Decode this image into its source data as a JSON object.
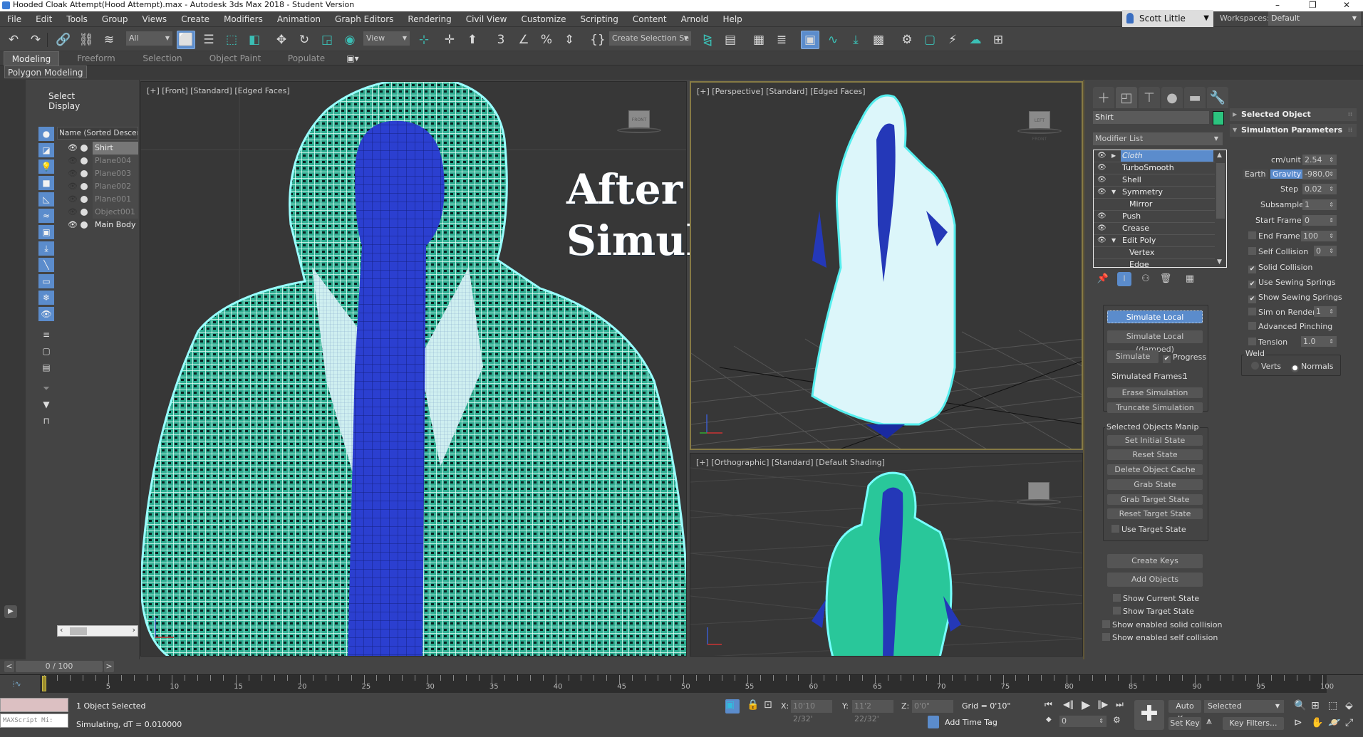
{
  "window": {
    "title": "Hooded Cloak Attempt(Hood Attempt).max - Autodesk 3ds Max 2018 - Student Version",
    "controls": [
      "minimize",
      "restore",
      "close"
    ]
  },
  "menu": {
    "items": [
      "File",
      "Edit",
      "Tools",
      "Group",
      "Views",
      "Create",
      "Modifiers",
      "Animation",
      "Graph Editors",
      "Rendering",
      "Civil View",
      "Customize",
      "Scripting",
      "Content",
      "Arnold",
      "Help"
    ],
    "user": "Scott Little",
    "workspaces_label": "Workspaces:",
    "workspace": "Default"
  },
  "toolbar": {
    "selection_filter": "All",
    "ref_coord": "View",
    "named_selection": "Create Selection Se"
  },
  "ribbon": {
    "tabs": [
      "Modeling",
      "Freeform",
      "Selection",
      "Object Paint",
      "Populate"
    ],
    "active_tab": "Modeling",
    "panel": "Polygon Modeling"
  },
  "explorer": {
    "tabs": [
      "Select",
      "Display"
    ],
    "column_header": "Name (Sorted Descend",
    "objects": [
      {
        "name": "Shirt",
        "visible": true,
        "selected": true
      },
      {
        "name": "Plane004",
        "visible": false,
        "selected": false
      },
      {
        "name": "Plane003",
        "visible": false,
        "selected": false
      },
      {
        "name": "Plane002",
        "visible": false,
        "selected": false
      },
      {
        "name": "Plane001",
        "visible": false,
        "selected": false
      },
      {
        "name": "Object001",
        "visible": false,
        "selected": false
      },
      {
        "name": "Main Body",
        "visible": true,
        "selected": false
      }
    ]
  },
  "viewports": {
    "front": "[+] [Front] [Standard] [Edged Faces]",
    "perspective": "[+] [Perspective] [Standard] [Edged Faces]",
    "orthographic": "[+] [Orthographic] [Standard] [Default Shading]",
    "overlay_line1": "After",
    "overlay_line2": "Simulation",
    "viewcube_front": "FRONT",
    "viewcube_persp_left": "LEFT",
    "viewcube_persp_front": "FRONT"
  },
  "command_panel": {
    "object_name": "Shirt",
    "object_color": "#2cc47f",
    "modifier_list": "Modifier List",
    "stack": [
      {
        "label": "Cloth",
        "selected": true,
        "expand": "collapsed"
      },
      {
        "label": "TurboSmooth"
      },
      {
        "label": "Shell"
      },
      {
        "label": "Symmetry",
        "expand": "expanded"
      },
      {
        "label": "Mirror",
        "sub": true
      },
      {
        "label": "Push"
      },
      {
        "label": "Crease"
      },
      {
        "label": "Edit Poly",
        "expand": "expanded"
      },
      {
        "label": "Vertex",
        "sub": true
      },
      {
        "label": "Edge",
        "sub": true
      }
    ],
    "buttons": {
      "simulate_local": "Simulate Local",
      "simulate_local_damped": "Simulate Local (damped)",
      "simulate": "Simulate",
      "progress": "Progress",
      "simulated_frames_label": "Simulated Frames:",
      "simulated_frames_value": "1",
      "erase_simulation": "Erase Simulation",
      "truncate_simulation": "Truncate Simulation"
    },
    "manip": {
      "title": "Selected Objects Manip",
      "set_initial_state": "Set Initial State",
      "reset_state": "Reset State",
      "delete_object_cache": "Delete Object Cache",
      "grab_state": "Grab State",
      "grab_target_state": "Grab Target State",
      "reset_target_state": "Reset Target State",
      "use_target_state": "Use Target State"
    },
    "create_keys": "Create Keys",
    "add_objects": "Add Objects",
    "show_current_state": "Show Current State",
    "show_target_state": "Show Target State",
    "show_enabled_solid": "Show enabled solid collision",
    "show_enabled_self": "Show enabled self collision"
  },
  "sim_params": {
    "selected_object": "Selected Object",
    "title": "Simulation Parameters",
    "cm_unit_label": "cm/unit",
    "cm_unit": "2.54",
    "earth": "Earth",
    "gravity": "Gravity",
    "gravity_value": "-980.0",
    "step_label": "Step",
    "step": "0.02",
    "subsample_label": "Subsample",
    "subsample": "1",
    "start_frame_label": "Start Frame",
    "start_frame": "0",
    "end_frame_label": "End Frame",
    "end_frame": "100",
    "self_collision_label": "Self Collision",
    "self_collision": "0",
    "solid_collision": "Solid Collision",
    "use_sewing": "Use Sewing Springs",
    "show_sewing": "Show Sewing Springs",
    "sim_on_render_label": "Sim on Render",
    "sim_on_render": "1",
    "advanced_pinching": "Advanced Pinching",
    "tension_label": "Tension",
    "tension": "1.0",
    "weld": "Weld",
    "verts": "Verts",
    "normals": "Normals"
  },
  "timeline": {
    "slider": "0 / 100",
    "current_frame": 0,
    "end": 100,
    "labels": [
      "0",
      "5",
      "10",
      "15",
      "20",
      "25",
      "30",
      "35",
      "40",
      "45",
      "50",
      "55",
      "60",
      "65",
      "70",
      "75",
      "80",
      "85",
      "90",
      "95",
      "100"
    ]
  },
  "status": {
    "maxscript": "MAXScript Mi:",
    "line1": "1 Object Selected",
    "line2": "Simulating, dT = 0.010000",
    "x_label": "X:",
    "x": "10'10 2/32'",
    "y_label": "Y:",
    "y": "11'2 22/32'",
    "z_label": "Z:",
    "z": "0'0\"",
    "grid": "Grid = 0'10\"",
    "add_time_tag": "Add Time Tag",
    "frame": "0",
    "auto_key": "Auto Key",
    "set_key": "Set Key",
    "key_mode": "Selected",
    "key_filters": "Key Filters..."
  }
}
